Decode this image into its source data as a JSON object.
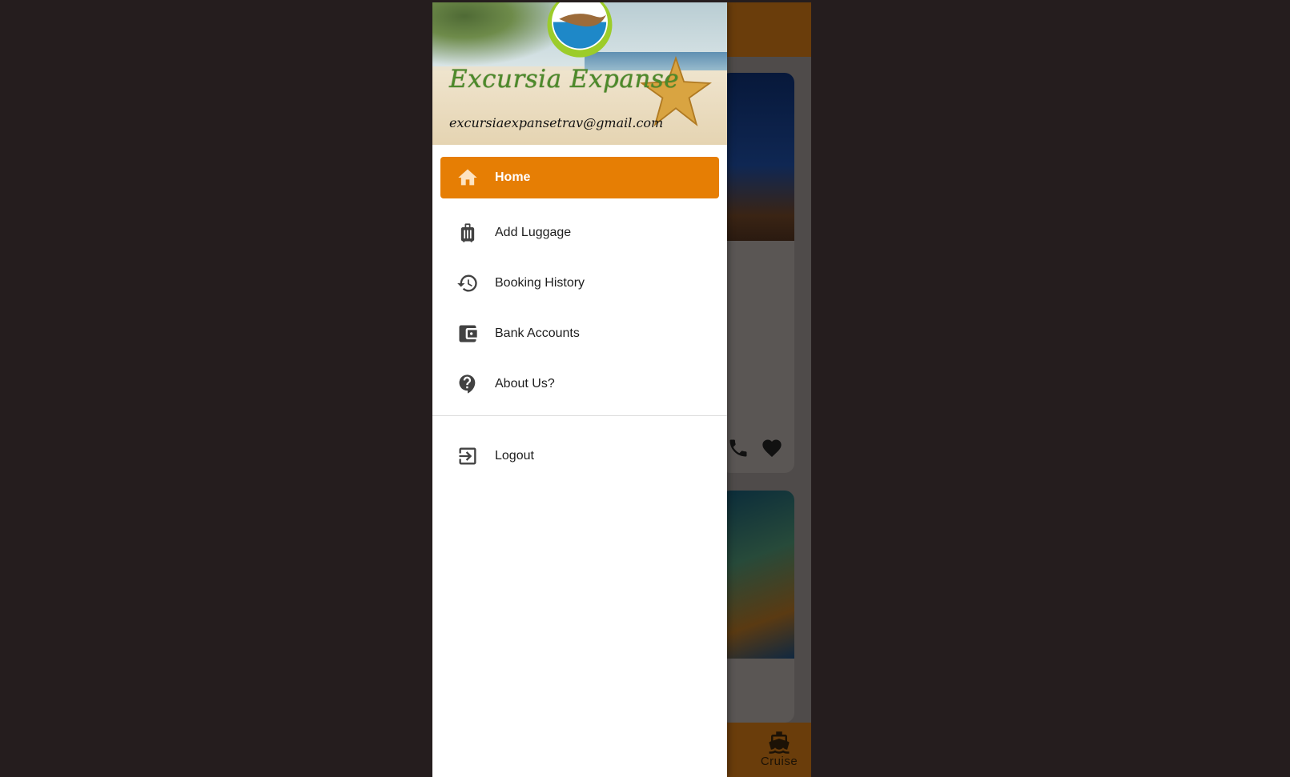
{
  "app": {
    "brand_name": "Excursia Expanse",
    "email": "excursiaexpansetrav@gmail.com"
  },
  "drawer": {
    "items": [
      {
        "label": "Home",
        "icon": "home-icon",
        "active": true
      },
      {
        "label": "Add Luggage",
        "icon": "luggage-icon",
        "active": false
      },
      {
        "label": "Booking History",
        "icon": "history-icon",
        "active": false
      },
      {
        "label": "Bank Accounts",
        "icon": "wallet-icon",
        "active": false
      },
      {
        "label": "About Us?",
        "icon": "help-icon",
        "active": false
      }
    ],
    "logout_label": "Logout"
  },
  "bottom_nav": {
    "cruise_label": "Cruise"
  },
  "colors": {
    "accent": "#e67e04",
    "brand_green": "#4d8a2a",
    "scrim": "#251d1e"
  }
}
